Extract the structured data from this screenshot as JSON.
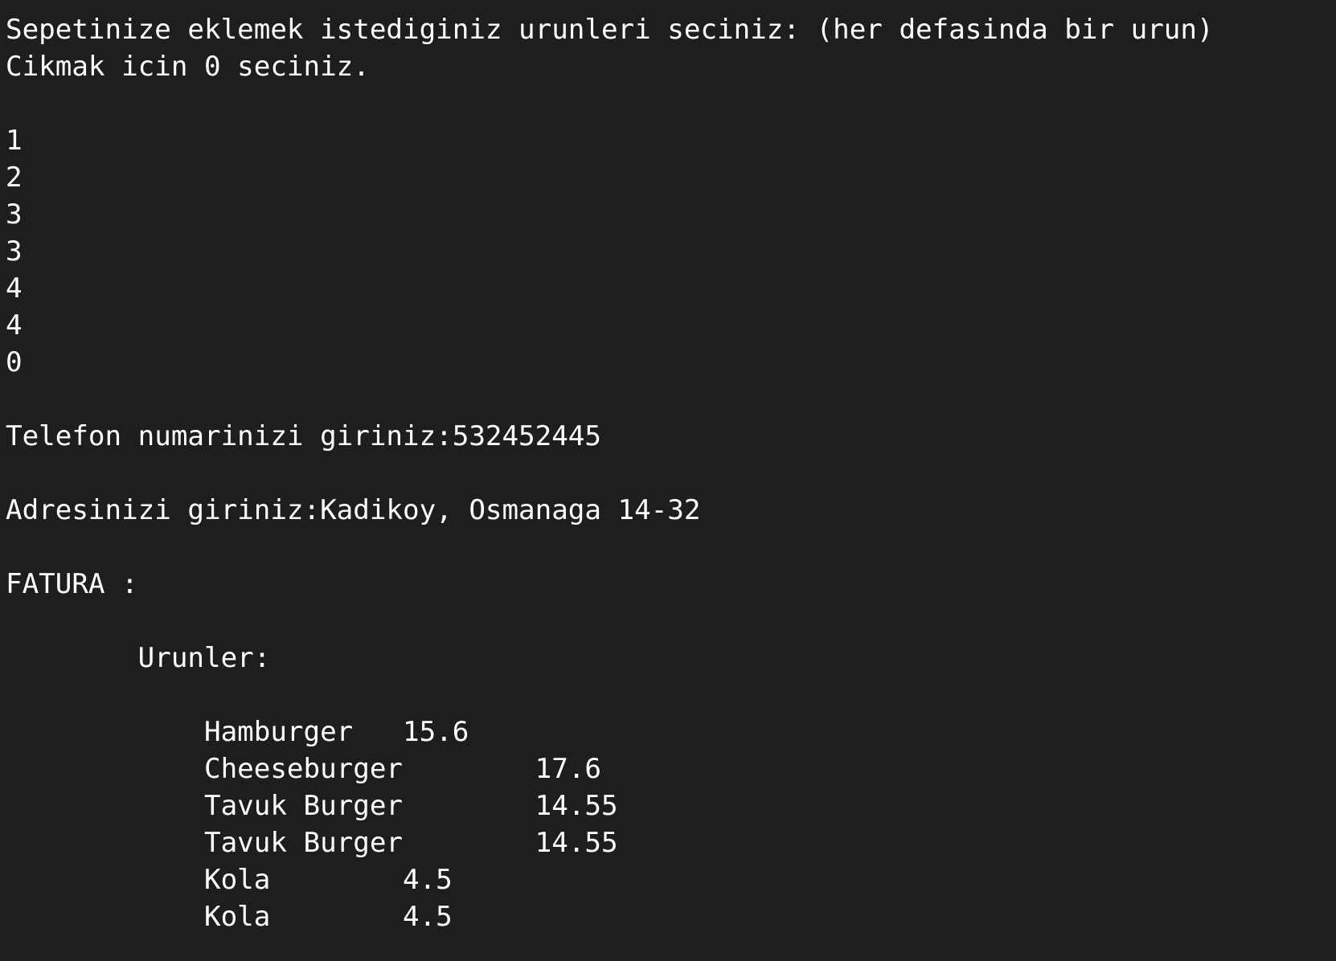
{
  "terminal": {
    "prompt_line_1": "Sepetinize eklemek istediginiz urunleri seciniz: (her defasinda bir urun)",
    "prompt_line_2": "Cikmak icin 0 seciniz.",
    "inputs": [
      "1",
      "2",
      "3",
      "3",
      "4",
      "4",
      "0"
    ],
    "phone_line": "Telefon numarinizi giriniz:532452445",
    "address_line": "Adresinizi giriniz:Kadikoy, Osmanaga 14-32",
    "invoice_heading": "FATURA :",
    "products_heading": "\tUrunler:",
    "products": [
      "\t    Hamburger   15.6",
      "\t    Cheeseburger        17.6",
      "\t    Tavuk Burger        14.55",
      "\t    Tavuk Burger        14.55",
      "\t    Kola        4.5",
      "\t    Kola        4.5"
    ]
  }
}
